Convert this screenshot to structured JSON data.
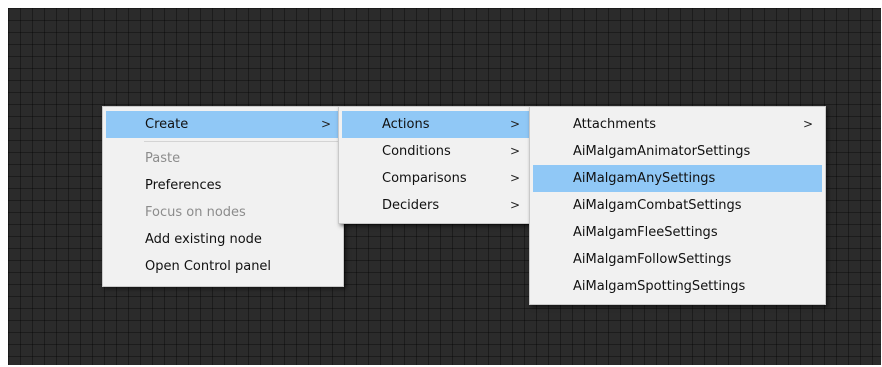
{
  "main_menu": {
    "create": "Create",
    "paste": "Paste",
    "preferences": "Preferences",
    "focus_on_nodes": "Focus on nodes",
    "add_existing_node": "Add existing node",
    "open_control_panel": "Open Control panel"
  },
  "create_submenu": {
    "actions": "Actions",
    "conditions": "Conditions",
    "comparisons": "Comparisons",
    "deciders": "Deciders"
  },
  "actions_submenu": {
    "attachments": "Attachments",
    "items": [
      "AiMalgamAnimatorSettings",
      "AiMalgamAnySettings",
      "AiMalgamCombatSettings",
      "AiMalgamFleeSettings",
      "AiMalgamFollowSettings",
      "AiMalgamSpottingSettings"
    ]
  },
  "icons": {
    "submenu_arrow": ">"
  },
  "colors": {
    "canvas_background": "#2b2b2b",
    "menu_background": "#f1f1f1",
    "highlight": "#90c8f6",
    "disabled_text": "#8c8c8c"
  }
}
